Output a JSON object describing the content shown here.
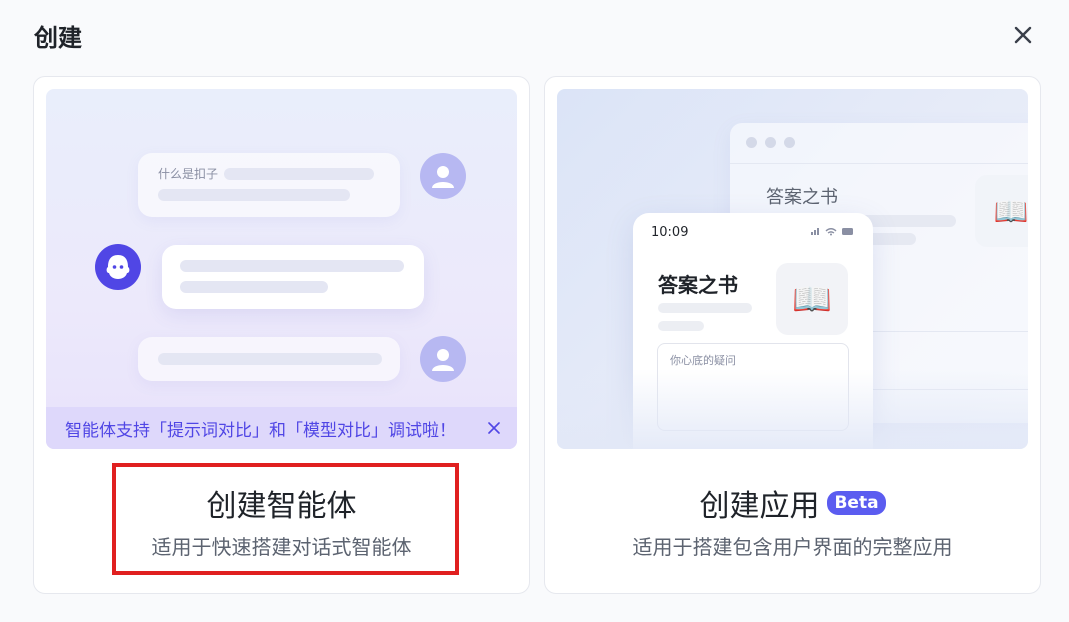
{
  "dialog": {
    "title": "创建",
    "close_icon": "close-icon"
  },
  "agent_card": {
    "title": "创建智能体",
    "subtitle": "适用于快速搭建对话式智能体",
    "preview": {
      "user_message": "什么是扣子",
      "banner_text": "智能体支持「提示词对比」和「模型对比」调试啦！",
      "banner_close_icon": "close-icon"
    }
  },
  "app_card": {
    "title": "创建应用",
    "badge": "Beta",
    "subtitle": "适用于搭建包含用户界面的完整应用",
    "preview": {
      "window_title": "答案之书",
      "phone_time": "10:09",
      "phone_status": "all ✱ ▬",
      "phone_title": "答案之书",
      "phone_icon": "📖",
      "input_placeholder": "你心底的疑问"
    }
  },
  "colors": {
    "accent": "#5046e5",
    "highlight": "#e02020",
    "banner_bg": "#ded8fb"
  }
}
